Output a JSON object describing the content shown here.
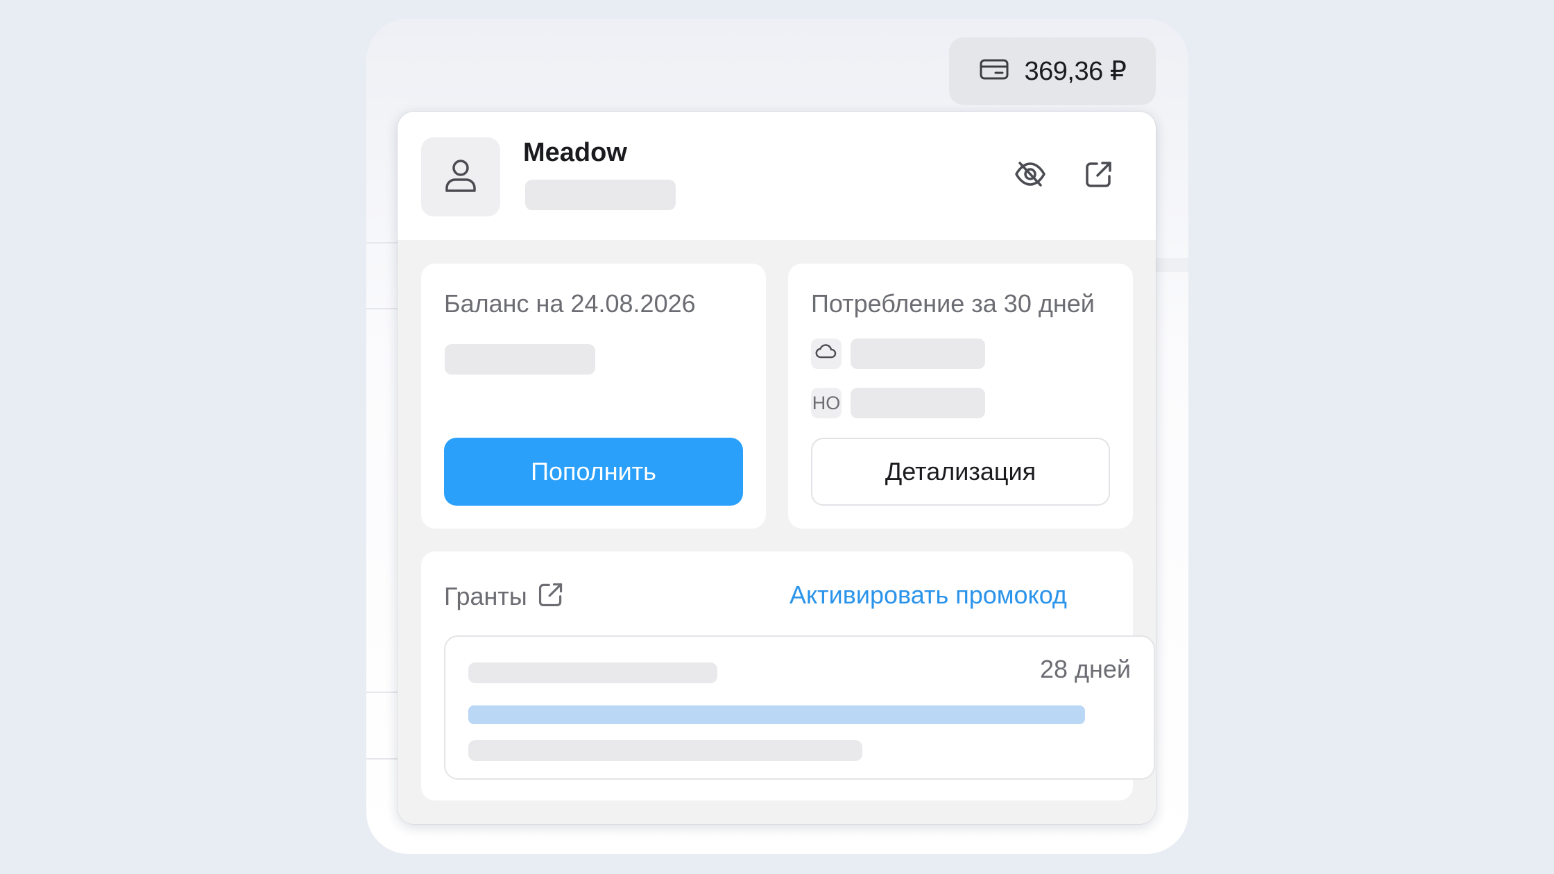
{
  "balance_pill": {
    "amount": "369,36 ₽",
    "icon": "credit-card-icon"
  },
  "account": {
    "name": "Meadow",
    "avatar_icon": "user-icon",
    "hide_icon": "eye-off-icon",
    "open_icon": "external-link-icon"
  },
  "balance_card": {
    "title": "Баланс на 24.08.2026",
    "top_up_label": "Пополнить"
  },
  "consumption_card": {
    "title": "Потребление за 30 дней",
    "rows": [
      {
        "icon": "cloud-icon",
        "tag": ""
      },
      {
        "icon": "",
        "tag": "НО"
      }
    ],
    "details_label": "Детализация"
  },
  "grants_card": {
    "title": "Гранты",
    "title_icon": "external-link-icon",
    "promo_link": "Активировать промокод",
    "grant": {
      "days_left": "28 дней",
      "progress": 1.0
    }
  },
  "colors": {
    "primary": "#2aa0fb",
    "link": "#2a93ea",
    "progress": "#bad7f5",
    "skeleton": "#e9e9eb"
  }
}
